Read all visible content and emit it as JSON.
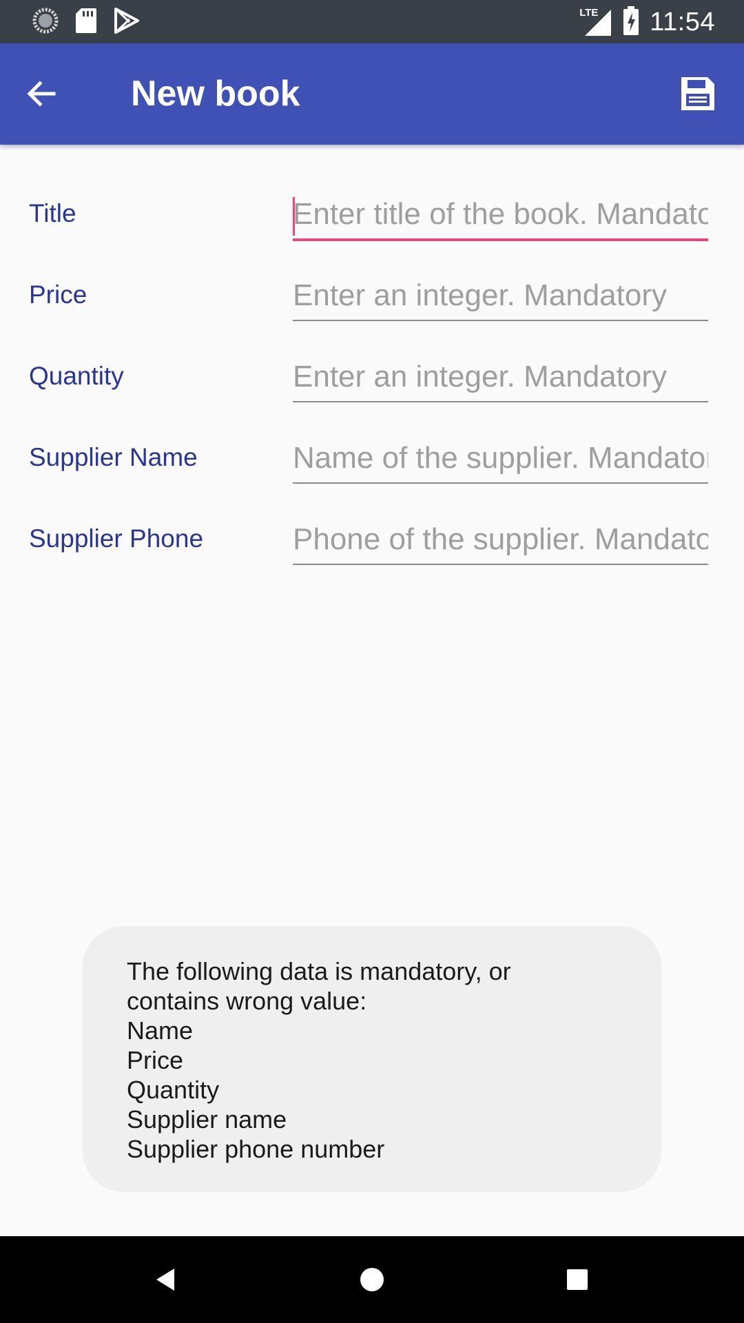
{
  "status_bar": {
    "time": "11:54",
    "network_label": "LTE",
    "left_icons": [
      "sync-icon",
      "sd-card-icon",
      "play-store-icon"
    ],
    "right_icons": [
      "signal-icon",
      "battery-charging-icon"
    ]
  },
  "app_bar": {
    "title": "New book",
    "back_icon": "arrow-back-icon",
    "save_icon": "save-icon"
  },
  "form": {
    "fields": [
      {
        "label": "Title",
        "placeholder": "Enter title of the book. Mandatory",
        "value": "",
        "focused": true
      },
      {
        "label": "Price",
        "placeholder": "Enter an integer. Mandatory",
        "value": "",
        "focused": false
      },
      {
        "label": "Quantity",
        "placeholder": "Enter an integer. Mandatory",
        "value": "",
        "focused": false
      },
      {
        "label": "Supplier Name",
        "placeholder": "Name of the supplier. Mandatory",
        "value": "",
        "focused": false
      },
      {
        "label": "Supplier Phone",
        "placeholder": "Phone of the supplier. Mandatory",
        "value": "",
        "focused": false
      }
    ]
  },
  "toast": {
    "lines": [
      "The following data is mandatory, or",
      "contains wrong value:",
      "Name",
      "Price",
      "Quantity",
      "Supplier name",
      "Supplier phone number"
    ]
  },
  "nav_bar": {
    "buttons": [
      "back-triangle-icon",
      "home-circle-icon",
      "recents-square-icon"
    ]
  },
  "colors": {
    "status_bar": "#394048",
    "app_bar": "#3f51b5",
    "label": "#283593",
    "accent": "#e8477e",
    "background": "#fafafa",
    "toast_bg": "#efefef"
  }
}
